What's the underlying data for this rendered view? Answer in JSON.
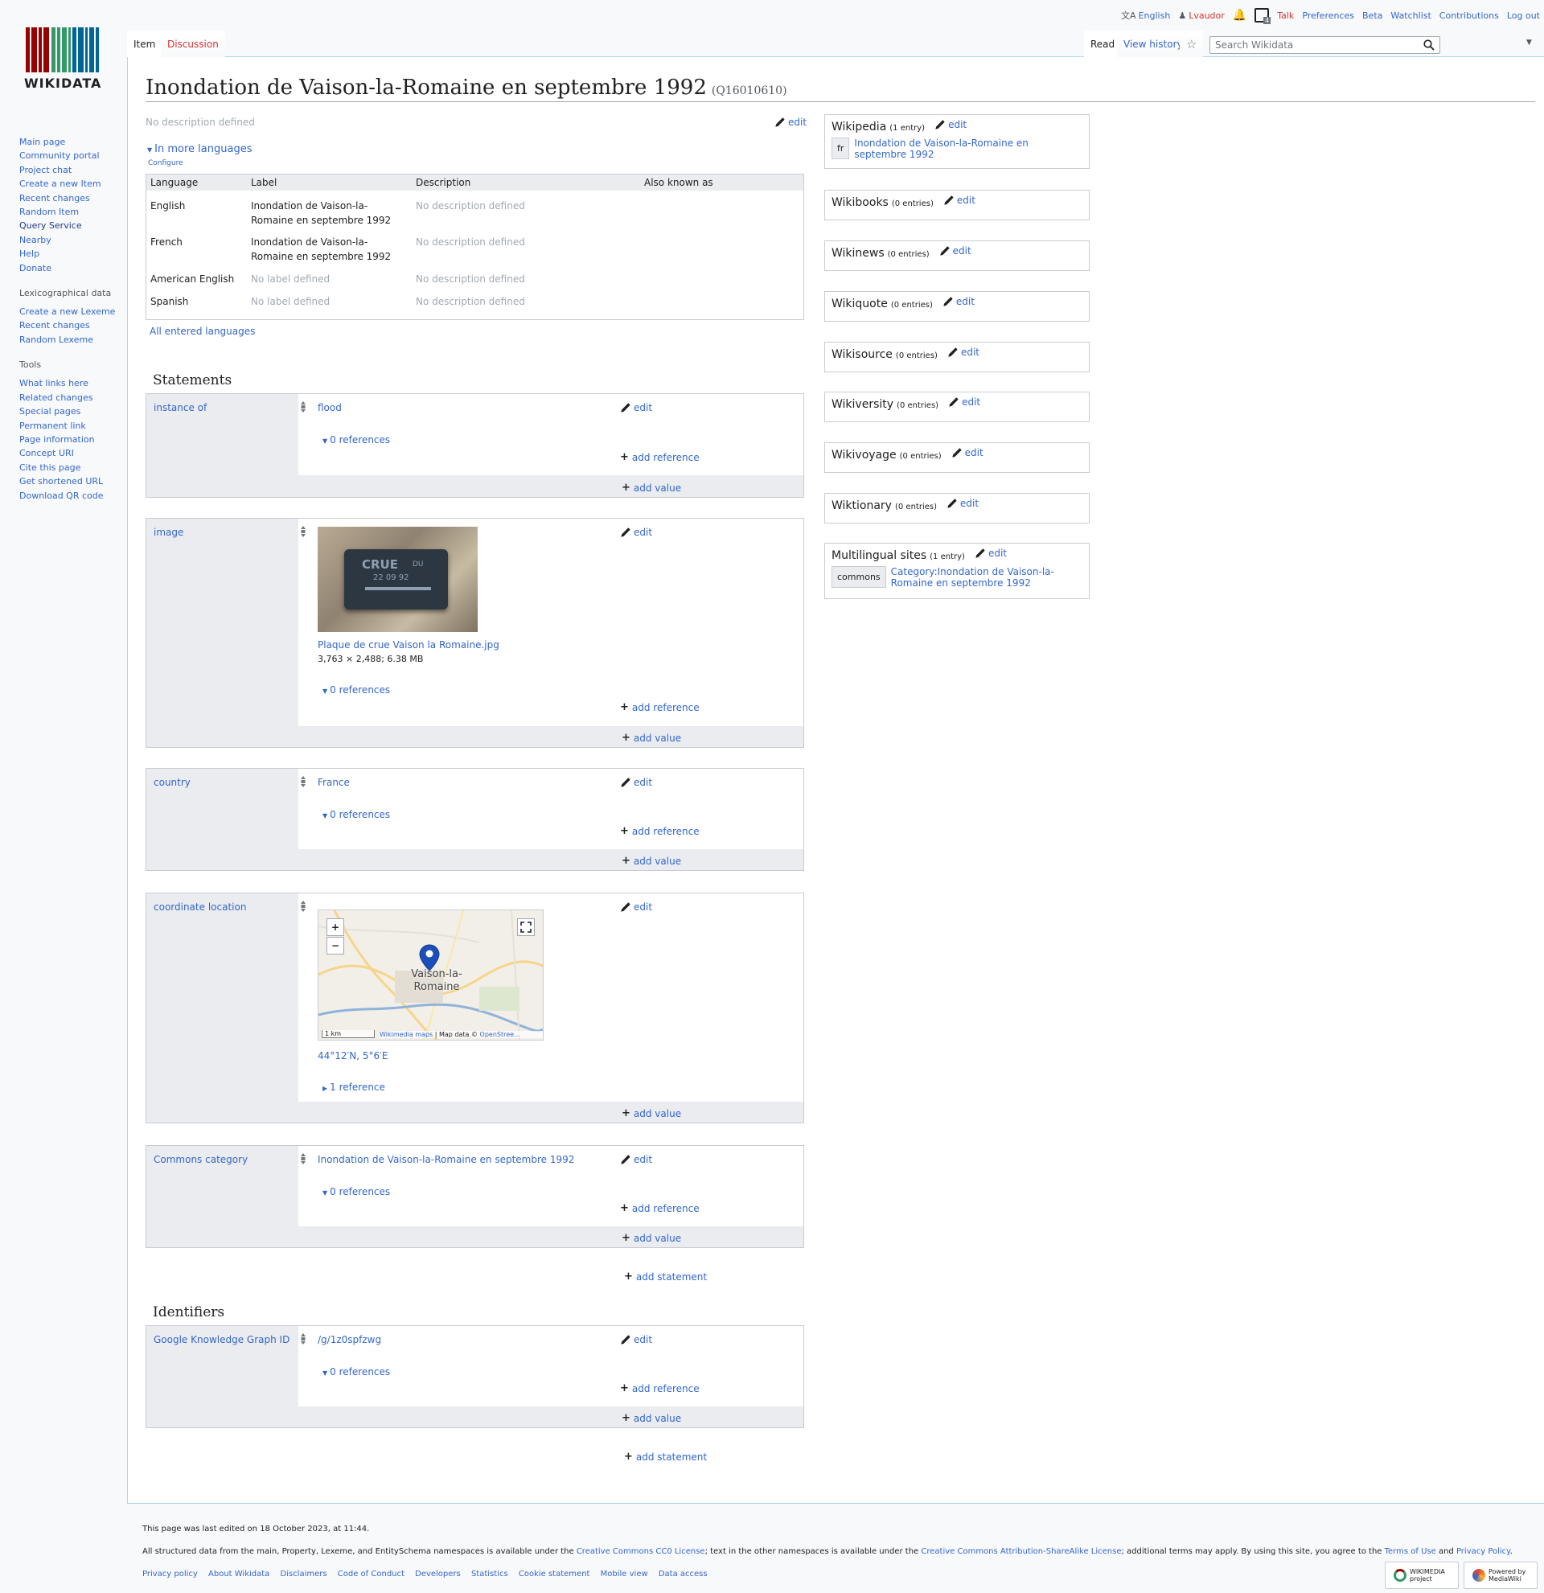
{
  "personal": {
    "language": "English",
    "user": "Lvaudor",
    "notifications_badge": "4",
    "links": [
      "Talk",
      "Preferences",
      "Beta",
      "Watchlist",
      "Contributions",
      "Log out"
    ]
  },
  "logo": {
    "text": "WIKIDATA"
  },
  "sidebar": {
    "main": [
      "Main page",
      "Community portal",
      "Project chat",
      "Create a new Item",
      "Recent changes",
      "Random Item",
      "Query Service",
      "Nearby",
      "Help",
      "Donate"
    ],
    "lexicographical_heading": "Lexicographical data",
    "lexicographical": [
      "Create a new Lexeme",
      "Recent changes",
      "Random Lexeme"
    ],
    "tools_heading": "Tools",
    "tools": [
      "What links here",
      "Related changes",
      "Special pages",
      "Permanent link",
      "Page information",
      "Concept URI",
      "Cite this page",
      "Get shortened URL",
      "Download QR code"
    ]
  },
  "tabs": {
    "item": "Item",
    "discussion": "Discussion",
    "read": "Read",
    "history": "View history"
  },
  "search": {
    "placeholder": "Search Wikidata"
  },
  "page": {
    "title": "Inondation de Vaison-la-Romaine en septembre 1992",
    "qid": "(Q16010610)",
    "description": "No description defined",
    "edit": "edit"
  },
  "languages": {
    "toggle": "In more languages",
    "configure": "Configure",
    "headers": [
      "Language",
      "Label",
      "Description",
      "Also known as"
    ],
    "rows": [
      {
        "lang": "English",
        "label": "Inondation de Vaison-la-Romaine en septembre 1992",
        "desc": "No description defined"
      },
      {
        "lang": "French",
        "label": "Inondation de Vaison-la-Romaine en septembre 1992",
        "desc": "No description defined"
      },
      {
        "lang": "American English",
        "label": "No label defined",
        "desc": "No description defined"
      },
      {
        "lang": "Spanish",
        "label": "No label defined",
        "desc": "No description defined"
      }
    ],
    "all": "All entered languages"
  },
  "statements_heading": "Statements",
  "identifiers_heading": "Identifiers",
  "common": {
    "edit": "edit",
    "add_reference": "add reference",
    "add_value": "add value",
    "add_statement": "add statement",
    "zero_refs": "0 references",
    "one_ref": "1 reference"
  },
  "statements": {
    "instance_of": {
      "prop": "instance of",
      "value": "flood"
    },
    "image": {
      "prop": "image",
      "file": "Plaque de crue Vaison la Romaine.jpg",
      "meta": "3,763 × 2,488; 6.38 MB",
      "plate_text": "CRUE",
      "plate_small": "DU",
      "plate_date": "22 09 92"
    },
    "country": {
      "prop": "country",
      "value": "France"
    },
    "coordinate": {
      "prop": "coordinate location",
      "value": "44°12′N, 5°6′E",
      "map_label": "Vaison-la-Romaine",
      "map_scale": "1 km",
      "map_attr_link": "Wikimedia maps",
      "map_attr_text": "| Map data ©",
      "map_attr_osm": "OpenStree..."
    },
    "commons": {
      "prop": "Commons category",
      "value": "Inondation de Vaison-la-Romaine en septembre 1992"
    },
    "kg": {
      "prop": "Google Knowledge Graph ID",
      "value": "/g/1z0spfzwg"
    }
  },
  "sitelinks": [
    {
      "name": "Wikipedia",
      "count": "(1 entry)",
      "code": "fr",
      "link": "Inondation de Vaison-la-Romaine en septembre 1992"
    },
    {
      "name": "Wikibooks",
      "count": "(0 entries)"
    },
    {
      "name": "Wikinews",
      "count": "(0 entries)"
    },
    {
      "name": "Wikiquote",
      "count": "(0 entries)"
    },
    {
      "name": "Wikisource",
      "count": "(0 entries)"
    },
    {
      "name": "Wikiversity",
      "count": "(0 entries)"
    },
    {
      "name": "Wikivoyage",
      "count": "(0 entries)"
    },
    {
      "name": "Wiktionary",
      "count": "(0 entries)"
    },
    {
      "name": "Multilingual sites",
      "count": "(1 entry)",
      "code": "commons",
      "link": "Category:Inondation de Vaison-la-Romaine en septembre 1992"
    }
  ],
  "footer": {
    "edited": "This page was last edited on 18 October 2023, at 11:44.",
    "license_1": "All structured data from the main, Property, Lexeme, and EntitySchema namespaces is available under the ",
    "license_cc0": "Creative Commons CC0 License",
    "license_2": "; text in the other namespaces is available under the ",
    "license_ccbysa": "Creative Commons Attribution-ShareAlike License",
    "license_3": "; additional terms may apply. By using this site, you agree to the ",
    "terms": "Terms of Use",
    "and": " and ",
    "privacy": "Privacy Policy",
    "dot": ".",
    "links": [
      "Privacy policy",
      "About Wikidata",
      "Disclaimers",
      "Code of Conduct",
      "Developers",
      "Statistics",
      "Cookie statement",
      "Mobile view",
      "Data access"
    ],
    "badge_wikimedia": "WIKIMEDIA project",
    "badge_mediawiki": "Powered by MediaWiki"
  },
  "colors": {
    "link": "#3366cc",
    "red_link": "#d73333",
    "border": "#c8ccd1",
    "gray_bg": "#eaecf0"
  }
}
